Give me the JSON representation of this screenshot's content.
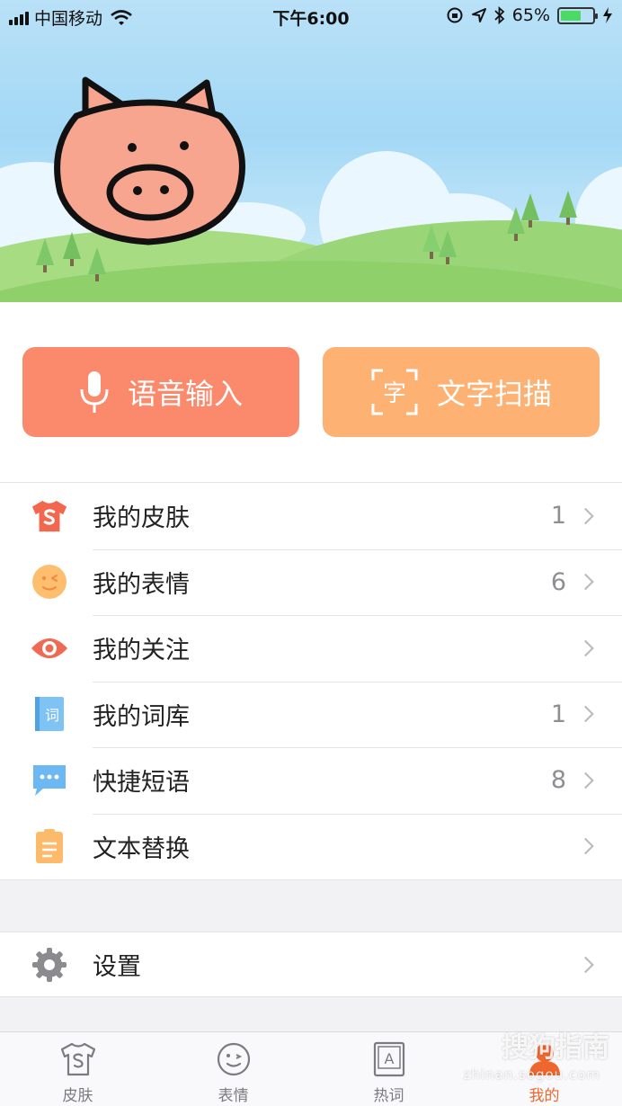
{
  "status_bar": {
    "carrier": "中国移动",
    "time": "下午6:00",
    "battery_percent": "65%",
    "battery_level": 0.65
  },
  "quick_actions": {
    "voice_input": "语音输入",
    "text_scan": "文字扫描",
    "scan_glyph": "字"
  },
  "menu": [
    {
      "label": "我的皮肤",
      "count": "1",
      "icon": "tshirt-icon"
    },
    {
      "label": "我的表情",
      "count": "6",
      "icon": "wink-face-icon"
    },
    {
      "label": "我的关注",
      "count": "",
      "icon": "eye-icon"
    },
    {
      "label": "我的词库",
      "count": "1",
      "icon": "book-icon",
      "icon_glyph": "词"
    },
    {
      "label": "快捷短语",
      "count": "8",
      "icon": "chat-bubble-icon"
    },
    {
      "label": "文本替换",
      "count": "",
      "icon": "clipboard-icon"
    }
  ],
  "settings": {
    "label": "设置",
    "icon": "gear-icon"
  },
  "tabs": [
    {
      "label": "皮肤",
      "icon": "tshirt-outline-icon"
    },
    {
      "label": "表情",
      "icon": "smiley-icon"
    },
    {
      "label": "热词",
      "icon": "hot-word-icon",
      "glyph": "A"
    },
    {
      "label": "我的",
      "icon": "profile-icon",
      "active": true
    }
  ],
  "watermark": {
    "text": "搜狗指南",
    "sub": "zhinan.sogou.com"
  },
  "colors": {
    "voice_button": "#fb8a6d",
    "scan_button": "#fdb173",
    "active_tab": "#f0672e",
    "sky": "#a3d8f5",
    "grass": "#8fd06b"
  }
}
